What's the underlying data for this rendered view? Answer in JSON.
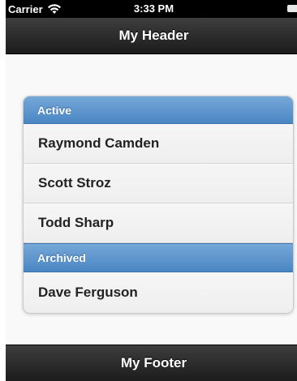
{
  "status_bar": {
    "carrier": "Carrier",
    "time": "3:33 PM",
    "wifi_icon": "wifi-icon",
    "battery_icon": "battery-icon"
  },
  "header": {
    "title": "My Header"
  },
  "list": {
    "groups": [
      {
        "divider": "Active",
        "items": [
          "Raymond Camden",
          "Scott Stroz",
          "Todd Sharp"
        ]
      },
      {
        "divider": "Archived",
        "items": [
          "Dave Ferguson"
        ]
      }
    ]
  },
  "footer": {
    "title": "My Footer"
  },
  "colors": {
    "divider": "#5b95cf",
    "bar": "#2b2b2b"
  }
}
